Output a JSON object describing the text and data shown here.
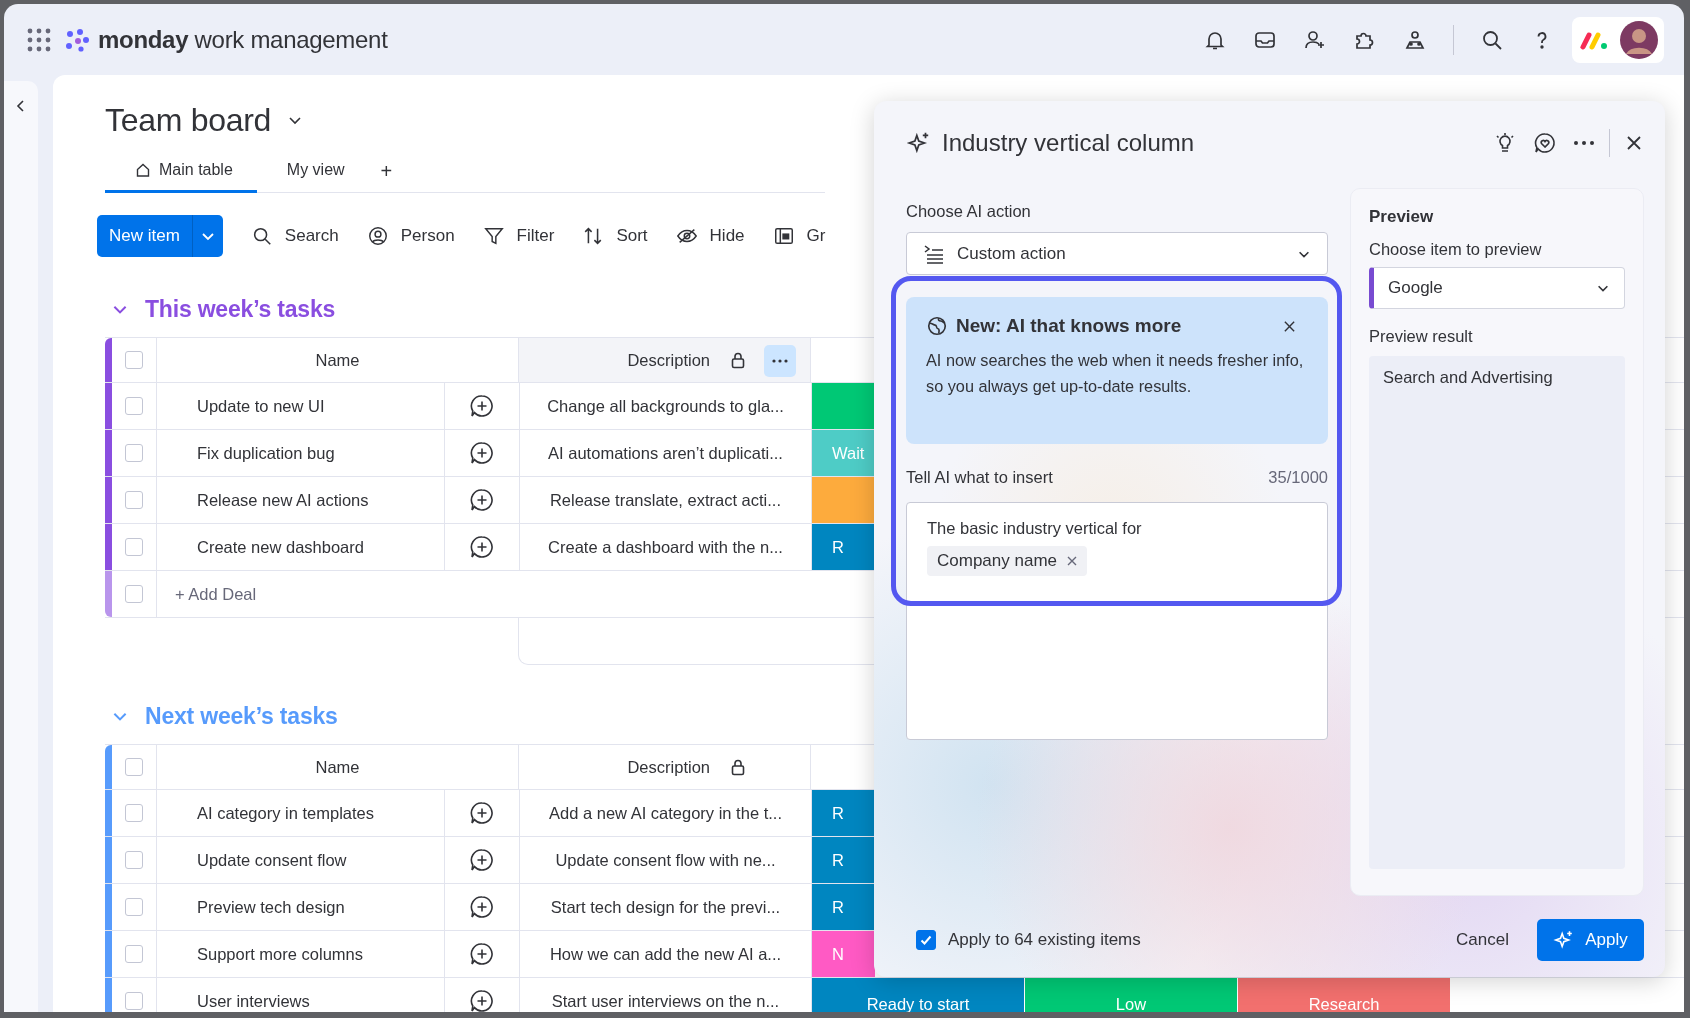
{
  "top_bar": {
    "brand_bold": "monday",
    "brand_rest": "work management"
  },
  "board": {
    "title": "Team board",
    "views": [
      {
        "label": "Main table",
        "selected": true
      },
      {
        "label": "My view",
        "selected": false
      }
    ],
    "add_view": "+",
    "toolbar": {
      "new_item": "New item",
      "tools": [
        {
          "kind": "search",
          "label": "Search"
        },
        {
          "kind": "person",
          "label": "Person"
        },
        {
          "kind": "filter",
          "label": "Filter"
        },
        {
          "kind": "sort",
          "label": "Sort"
        },
        {
          "kind": "hide",
          "label": "Hide"
        },
        {
          "kind": "group",
          "label": "Gr"
        }
      ]
    },
    "groups": [
      {
        "title": "This week’s tasks",
        "color": "#8a4ee0",
        "name_header": "Name",
        "description_header": "Description",
        "description_selected": true,
        "header_checked": false,
        "add_row": "+ Add Deal",
        "add_row_checked": false,
        "rows": [
          {
            "name": "Update to new UI",
            "checked": false,
            "description": "Change all backgrounds to gla...",
            "status": {
              "color": "#00c875"
            }
          },
          {
            "name": "Fix duplication bug",
            "checked": false,
            "description": "AI automations aren’t duplicati...",
            "status": {
              "label": "Wait",
              "color": "#4eccc6"
            }
          },
          {
            "name": "Release new AI actions",
            "checked": false,
            "description": "Release translate, extract acti...",
            "status": {
              "color": "#fdab3d"
            }
          },
          {
            "name": "Create new dashboard",
            "checked": false,
            "description": "Create a dashboard with the n...",
            "status": {
              "label": "R",
              "color": "#0086c0"
            }
          }
        ]
      },
      {
        "title": "Next week’s tasks",
        "color": "#579bfc",
        "name_header": "Name",
        "description_header": "Description",
        "description_selected": false,
        "header_checked": false,
        "rows": [
          {
            "name": "AI category in templates",
            "checked": false,
            "description": "Add a new AI category in the t...",
            "status": {
              "label": "R",
              "color": "#0086c0"
            }
          },
          {
            "name": "Update consent flow",
            "checked": false,
            "description": "Update consent flow with ne...",
            "status": {
              "label": "R",
              "color": "#0086c0"
            }
          },
          {
            "name": "Preview tech design",
            "checked": false,
            "description": "Start tech design for the previ...",
            "status": {
              "label": "R",
              "color": "#0086c0"
            }
          },
          {
            "name": "Support more columns",
            "checked": false,
            "description": "How we can add the new AI a...",
            "status": {
              "label": "N",
              "color": "#ff5ac4"
            }
          },
          {
            "name": "User interviews",
            "checked": false,
            "description": "Start user interviews on the n...",
            "status": {
              "label": "Ready to start",
              "color": "#0086c0"
            },
            "more": [
              {
                "label": "Low",
                "color": "#00c875"
              },
              {
                "label": "Research",
                "color": "#f2706e"
              }
            ]
          }
        ]
      }
    ]
  },
  "panel": {
    "title": "Industry vertical column",
    "action_label": "Choose AI action",
    "action_value": "Custom action",
    "notice": {
      "title": "New: AI that knows more",
      "body": "AI now searches the web when it needs fresher info, so you always get up-to-date results."
    },
    "prompt_label": "Tell AI what to insert",
    "prompt_count": "35/1000",
    "prompt_text": "The basic industry vertical for",
    "prompt_chip": "Company name",
    "preview": {
      "title": "Preview",
      "item_label": "Choose item to preview",
      "item_value": "Google",
      "result_label": "Preview result",
      "result": "Search and Advertising"
    },
    "apply_existing": {
      "label": "Apply to 64 existing items",
      "checked": true
    },
    "cancel": "Cancel",
    "apply": "Apply"
  }
}
